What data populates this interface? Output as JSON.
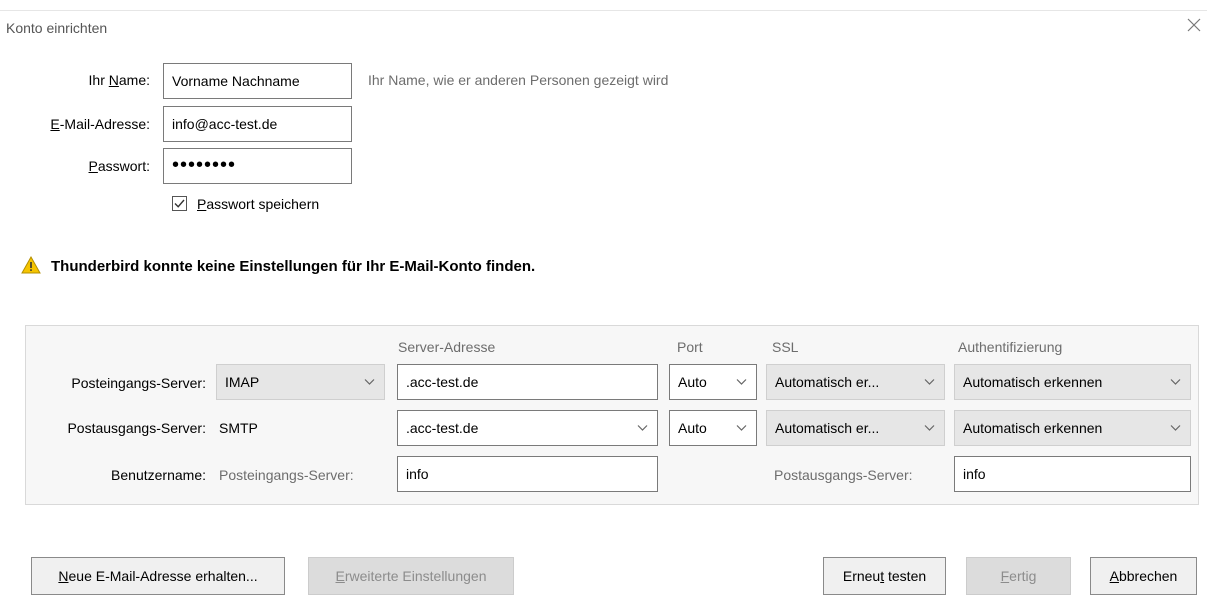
{
  "window": {
    "title": "Konto einrichten"
  },
  "form": {
    "name_label_pre": "Ihr ",
    "name_label_u": "N",
    "name_label_post": "ame:",
    "name_value": "Vorname Nachname",
    "name_hint": "Ihr Name, wie er anderen Personen gezeigt wird",
    "email_label_u": "E",
    "email_label_post": "-Mail-Adresse:",
    "email_value": "info@acc-test.de",
    "password_label_u": "P",
    "password_label_post": "asswort:",
    "password_value": "••••••••",
    "save_password_u": "P",
    "save_password_post": "asswort speichern",
    "save_password_checked": true
  },
  "warning": {
    "text": "Thunderbird konnte keine Einstellungen für Ihr E-Mail-Konto finden."
  },
  "server_table": {
    "headers": {
      "address": "Server-Adresse",
      "port": "Port",
      "ssl": "SSL",
      "auth": "Authentifizierung"
    },
    "incoming": {
      "label": "Posteingangs-Server:",
      "protocol": "IMAP",
      "address": ".acc-test.de",
      "port": "Auto",
      "ssl": "Automatisch er...",
      "auth": "Automatisch erkennen"
    },
    "outgoing": {
      "label": "Postausgangs-Server:",
      "protocol": "SMTP",
      "address": ".acc-test.de",
      "port": "Auto",
      "ssl": "Automatisch er...",
      "auth": "Automatisch erkennen"
    },
    "username": {
      "label": "Benutzername:",
      "incoming_label": "Posteingangs-Server:",
      "incoming_value": "info",
      "outgoing_label": "Postausgangs-Server:",
      "outgoing_value": "info"
    }
  },
  "buttons": {
    "new_email_u": "N",
    "new_email_post": "eue E-Mail-Adresse erhalten...",
    "advanced_u": "E",
    "advanced_post": "rweiterte Einstellungen",
    "retest_pre": "Erneu",
    "retest_u": "t",
    "retest_post": " testen",
    "done_u": "F",
    "done_post": "ertig",
    "cancel_u": "A",
    "cancel_post": "bbrechen"
  },
  "colors": {
    "warning": "#f5c400",
    "disabled_bg": "#dcdcdc",
    "panel_bg": "#f7f7f7"
  }
}
